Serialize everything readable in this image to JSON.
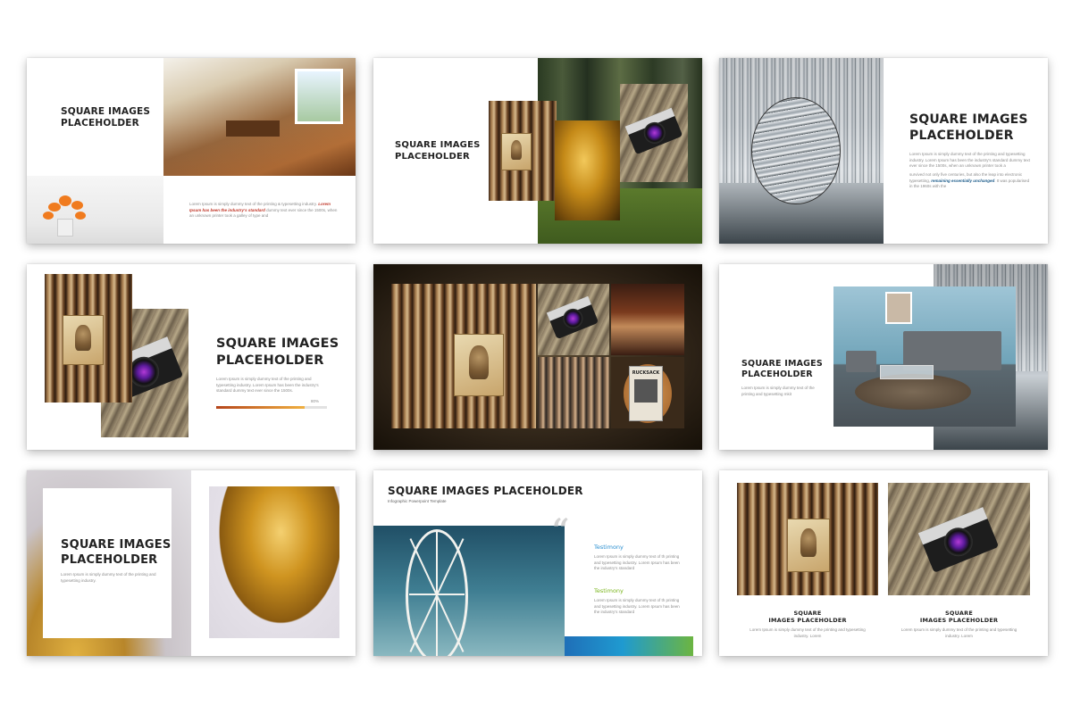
{
  "slides": {
    "s1": {
      "title_l1": "SQUARE IMAGES",
      "title_l2": "PLACEHOLDER",
      "body_pre": "Lorem Ipsum is simply dummy text of the printing & typesetting industry. ",
      "body_hl": "Lorem Ipsum has been the industry's standard",
      "body_post": " dummy text ever since the 1500s, when an unknown printer took a galley of type and"
    },
    "s2": {
      "title_l1": "SQUARE IMAGES",
      "title_l2": "PLACEHOLDER"
    },
    "s3": {
      "title_l1": "SQUARE IMAGES",
      "title_l2": "PLACEHOLDER",
      "body1": "Lorem Ipsum is simply dummy text of the printing and typesetting industry. Lorem Ipsum has been the industry's standard dummy text ever since the 1500s, when an unknown printer took a",
      "body2_pre": "survived not only five centuries, but also the leap into electronic typesetting, ",
      "body2_hl": "remaining essentially unchanged",
      "body2_post": ". It was popularised in the 1960s with the"
    },
    "s4": {
      "title_l1": "SQUARE IMAGES",
      "title_l2": "PLACEHOLDER",
      "body": "Lorem Ipsum is simply dummy text of the printing and typesetting industry. Lorem Ipsum has been the industry's standard dummy text ever since the 1500s.",
      "progress_label": "80%",
      "progress_value": 0.8
    },
    "s5": {
      "book_label": "RUCKSACK"
    },
    "s6": {
      "title_l1": "SQUARE IMAGES",
      "title_l2": "PLACEHOLDER",
      "body": "Lorem Ipsum is simply dummy text of the printing and typesetting mkit"
    },
    "s7": {
      "title_l1": "SQUARE IMAGES",
      "title_l2": "PLACEHOLDER",
      "body": "Lorem Ipsum is simply dummy text of the printing and typesetting industry."
    },
    "s8": {
      "title": "SQUARE IMAGES PLACEHOLDER",
      "subtitle": "Infographic Powerpoint Template",
      "quote_mark": "“",
      "t1_title": "Testimony",
      "t1_body": "Lorem Ipsum is simply dummy text of th printing and typesetting industry. Lorem Ipsum has been the industry's standard",
      "t2_title": "Testimony",
      "t2_body": "Lorem Ipsum is simply dummy text of th printing and typesetting industry. Lorem Ipsum has been the industry's standard"
    },
    "s9": {
      "c1_l1": "SQUARE",
      "c1_l2": "IMAGES PLACEHOLDER",
      "c1_body": "Lorem Ipsum is simply dummy text of the printing and typesetting industry. Lorem",
      "c2_l1": "SQUARE",
      "c2_l2": "IMAGES PLACEHOLDER",
      "c2_body": "Lorem Ipsum is simply dummy text of the printing and typesetting industry. Lorem"
    }
  },
  "colors": {
    "highlight_red": "#c0392b",
    "highlight_blue": "#1f5e8c",
    "testimony_blue": "#2a8fd0",
    "testimony_green": "#7ab51d",
    "progress_start": "#b5451b",
    "progress_end": "#f0b040"
  },
  "icons": [
    "camera-photo",
    "gold-statue-photo",
    "kitchen-photo",
    "flowers-photo",
    "file-drawers-photo",
    "living-room-photo",
    "ferris-wheel-photo",
    "quote-icon"
  ]
}
